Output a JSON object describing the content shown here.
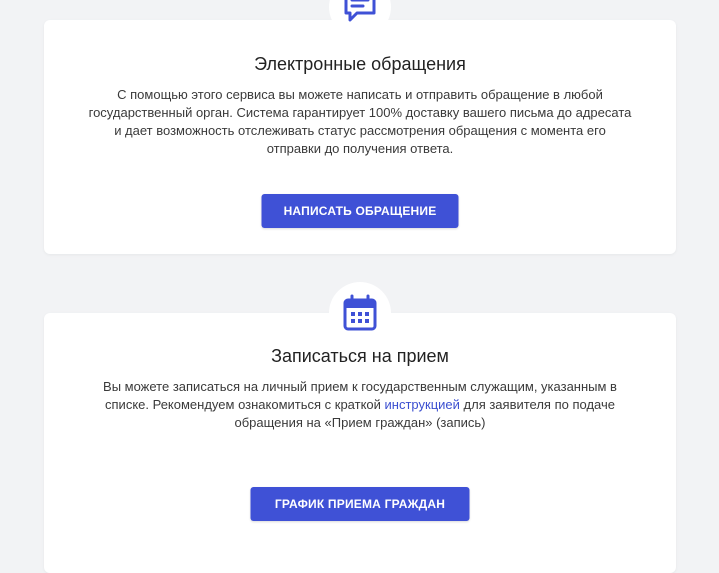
{
  "colors": {
    "accent": "#3f51d6",
    "link": "#3b4fd0",
    "background": "#f2f3f5"
  },
  "appeals": {
    "icon": "message-icon",
    "title": "Электронные обращения",
    "text_lines": [
      "С помощью этого сервиса вы можете написать и отправить обращение в любой",
      "государственный орган. Система гарантирует 100% доставку вашего письма до адресата",
      "и дает возможность отслеживать статус рассмотрения обращения с момента его",
      "отправки до получения ответа."
    ],
    "button_label": "НАПИСАТЬ ОБРАЩЕНИЕ"
  },
  "reception": {
    "icon": "calendar-icon",
    "title": "Записаться на прием",
    "line1": "Вы можете записаться на личный прием к государственным служащим, указанным в",
    "line2_before": "списке. Рекомендуем ознакомиться с краткой ",
    "line2_link": "инструкцией",
    "line2_after": " для заявителя по подаче",
    "line3": "обращения на «Прием граждан» (запись)",
    "button_label": "ГРАФИК ПРИЕМА ГРАЖДАН"
  }
}
